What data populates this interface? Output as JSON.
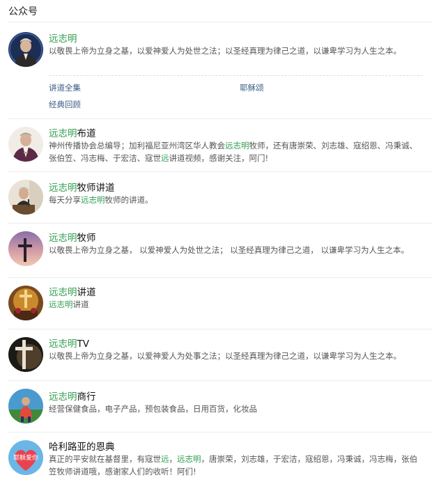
{
  "section": {
    "title": "公众号"
  },
  "highlight_color": "#2f9d4e",
  "accounts": [
    {
      "name_hl": "远志明",
      "name_rest": "",
      "description": [
        {
          "t": "以敬畏上帝为立身之基，以爱神爱人为处世之法；以圣经真理为律己之道，以谦卑学习为人生之本。",
          "hl": false
        }
      ],
      "menu": [
        "讲道全集",
        "耶稣颂",
        "经典回顾"
      ],
      "avatar_icon": "portrait-icon"
    },
    {
      "name_hl": "远志明",
      "name_rest": "布道",
      "description": [
        {
          "t": "神州传播协会总编导；加利福尼亚州湾区华人教会",
          "hl": false
        },
        {
          "t": "远志明",
          "hl": true
        },
        {
          "t": "牧师，还有唐崇荣、刘志雄、寇绍恩、冯秉诚、张伯笠、冯志梅、于宏洁、寇世",
          "hl": false
        },
        {
          "t": "远",
          "hl": true
        },
        {
          "t": "讲道视频，感谢关注，阿门!",
          "hl": false
        }
      ],
      "avatar_icon": "portrait-icon"
    },
    {
      "name_hl": "远志明",
      "name_rest": "牧师讲道",
      "description": [
        {
          "t": "每天分享",
          "hl": false
        },
        {
          "t": "远志明",
          "hl": true
        },
        {
          "t": "牧师的讲道。",
          "hl": false
        }
      ],
      "avatar_icon": "preacher-icon"
    },
    {
      "name_hl": "远志明",
      "name_rest": "牧师",
      "description": [
        {
          "t": "以敬畏上帝为立身之基， 以爱神爱人为处世之法； 以圣经真理为律己之道， 以谦卑学习为人生之本。",
          "hl": false
        }
      ],
      "avatar_icon": "cross-sunset-icon"
    },
    {
      "name_hl": "远志明",
      "name_rest": "讲道",
      "description": [
        {
          "t": "远志明",
          "hl": true
        },
        {
          "t": "讲道",
          "hl": false
        }
      ],
      "avatar_icon": "church-cross-icon"
    },
    {
      "name_hl": "远志明",
      "name_rest": "TV",
      "description": [
        {
          "t": "以敬畏上帝为立身之基，以爱神爱人为处事之法；以圣经真理为律己之道，以谦卑学习为人生之本。",
          "hl": false
        }
      ],
      "avatar_icon": "dark-cross-icon"
    },
    {
      "name_hl": "远志明",
      "name_rest": "商行",
      "description": [
        {
          "t": "经营保健食品，电子产品，预包装食品，日用百货，化妆品",
          "hl": false
        }
      ],
      "avatar_icon": "person-outdoor-icon"
    },
    {
      "name_hl": "",
      "name_rest": "哈利路亚的恩典",
      "description": [
        {
          "t": "真正的平安就在基督里，有寇世",
          "hl": false
        },
        {
          "t": "远",
          "hl": true
        },
        {
          "t": "，",
          "hl": false
        },
        {
          "t": "远志明",
          "hl": true
        },
        {
          "t": "，唐崇荣，刘志雄，于宏洁，寇绍恩，冯秉诚，冯志梅，张伯笠牧师讲道哦，感谢家人们的收听！阿们!",
          "hl": false
        }
      ],
      "avatar_text": "耶稣爱你",
      "avatar_icon": "heart-banner-icon"
    }
  ]
}
